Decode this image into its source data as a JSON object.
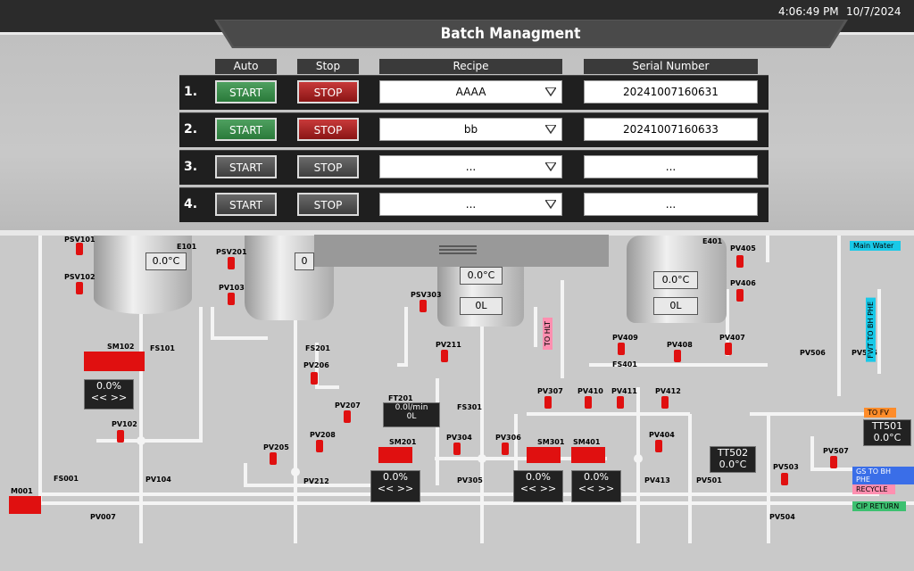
{
  "header": {
    "time": "4:06:49 PM",
    "date": "10/7/2024",
    "title": "Batch Managment"
  },
  "columns": {
    "auto": "Auto",
    "stop": "Stop",
    "recipe": "Recipe",
    "serial": "Serial Number"
  },
  "batches": [
    {
      "num": "1.",
      "start": "START",
      "stop": "STOP",
      "recipe": "AAAA",
      "serial": "20241007160631",
      "start_active": true,
      "stop_active": true
    },
    {
      "num": "2.",
      "start": "START",
      "stop": "STOP",
      "recipe": "bb",
      "serial": "20241007160633",
      "start_active": true,
      "stop_active": true
    },
    {
      "num": "3.",
      "start": "START",
      "stop": "STOP",
      "recipe": "...",
      "serial": "...",
      "start_active": false,
      "stop_active": false
    },
    {
      "num": "4.",
      "start": "START",
      "stop": "STOP",
      "recipe": "...",
      "serial": "...",
      "start_active": false,
      "stop_active": false
    }
  ],
  "colors": {
    "valve": "#e01010",
    "start_green": "#2a7a3a",
    "stop_red": "#8a1515",
    "pipe": "#f2f2f2"
  },
  "plant": {
    "tank1_temp": "0.0°C",
    "tank2_temp": "0",
    "tank3_temp": "0.0°C",
    "tank3_level": "0L",
    "tank4_temp": "0.0°C",
    "tank4_level": "0L",
    "sm102": {
      "tag": "SM102",
      "value": "0.0%",
      "ctrl": "<<      >>"
    },
    "sm201": {
      "tag": "SM201",
      "value": "0.0%",
      "ctrl": "<<      >>"
    },
    "sm301": {
      "tag": "SM301",
      "value": "0.0%",
      "ctrl": "<<      >>"
    },
    "sm401": {
      "tag": "SM401",
      "value": "0.0%",
      "ctrl": "<<      >>"
    },
    "ft201": {
      "tag": "FT201",
      "flow": "0.0l/min",
      "total": "0L"
    },
    "tt501": {
      "tag": "TT501",
      "value": "0.0°C"
    },
    "tt502": {
      "tag": "TT502",
      "value": "0.0°C"
    },
    "tags": {
      "psv101": "PSV101",
      "psv102": "PSV102",
      "e101": "E101",
      "psv201": "PSV201",
      "pv103": "PV103",
      "psv303": "PSV303",
      "e401": "E401",
      "pv405": "PV405",
      "pv406": "PV406",
      "fs101": "FS101",
      "fs201": "FS201",
      "pv206": "PV206",
      "pv211": "PV211",
      "pv409": "PV409",
      "pv408": "PV408",
      "pv407": "PV407",
      "fs401": "FS401",
      "pv506": "PV506",
      "pv505": "PV505",
      "pv207": "PV207",
      "pv307": "PV307",
      "pv410": "PV410",
      "pv411": "PV411",
      "pv412": "PV412",
      "fs301": "FS301",
      "pv102": "PV102",
      "pv208": "PV208",
      "pv205": "PV205",
      "pv304": "PV304",
      "pv306": "PV306",
      "pv404": "PV404",
      "pv507": "PV507",
      "pv104": "PV104",
      "pv212": "PV212",
      "pv305": "PV305",
      "pv413": "PV413",
      "pv501": "PV501",
      "pv503": "PV503",
      "m001": "M001",
      "fs001": "FS001",
      "pv007": "PV007",
      "pv504": "PV504"
    },
    "labels": {
      "main_water": "Main Water",
      "fwt_bh": "FWT TO BH PHE",
      "to_hlt": "TO HLT",
      "to_fv": "TO FV",
      "gs_bh": "GS TO BH PHE",
      "recycle": "RECYCLE",
      "cip_return": "CIP RETURN"
    }
  }
}
